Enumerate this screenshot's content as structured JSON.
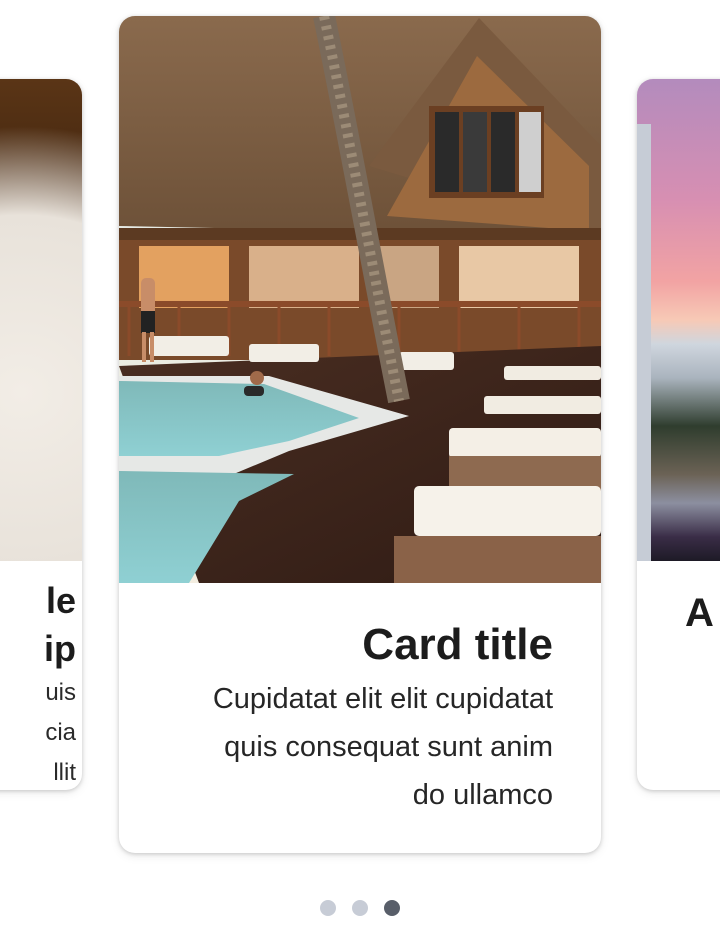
{
  "carousel": {
    "cards": [
      {
        "title_lines": [
          "le",
          "ip"
        ],
        "text_lines": [
          "uis",
          "cia",
          "llit"
        ]
      },
      {
        "title": "Card title",
        "text_lines": [
          "Cupidatat elit elit cupidatat",
          "quis consequat sunt anim",
          "do ullamco"
        ]
      },
      {
        "title": "A"
      }
    ],
    "dots": [
      {
        "active": false
      },
      {
        "active": false
      },
      {
        "active": true
      }
    ]
  },
  "colors": {
    "dot_inactive": "#c7ccd6",
    "dot_active": "#585e69",
    "title_text": "#1c1c1c"
  }
}
